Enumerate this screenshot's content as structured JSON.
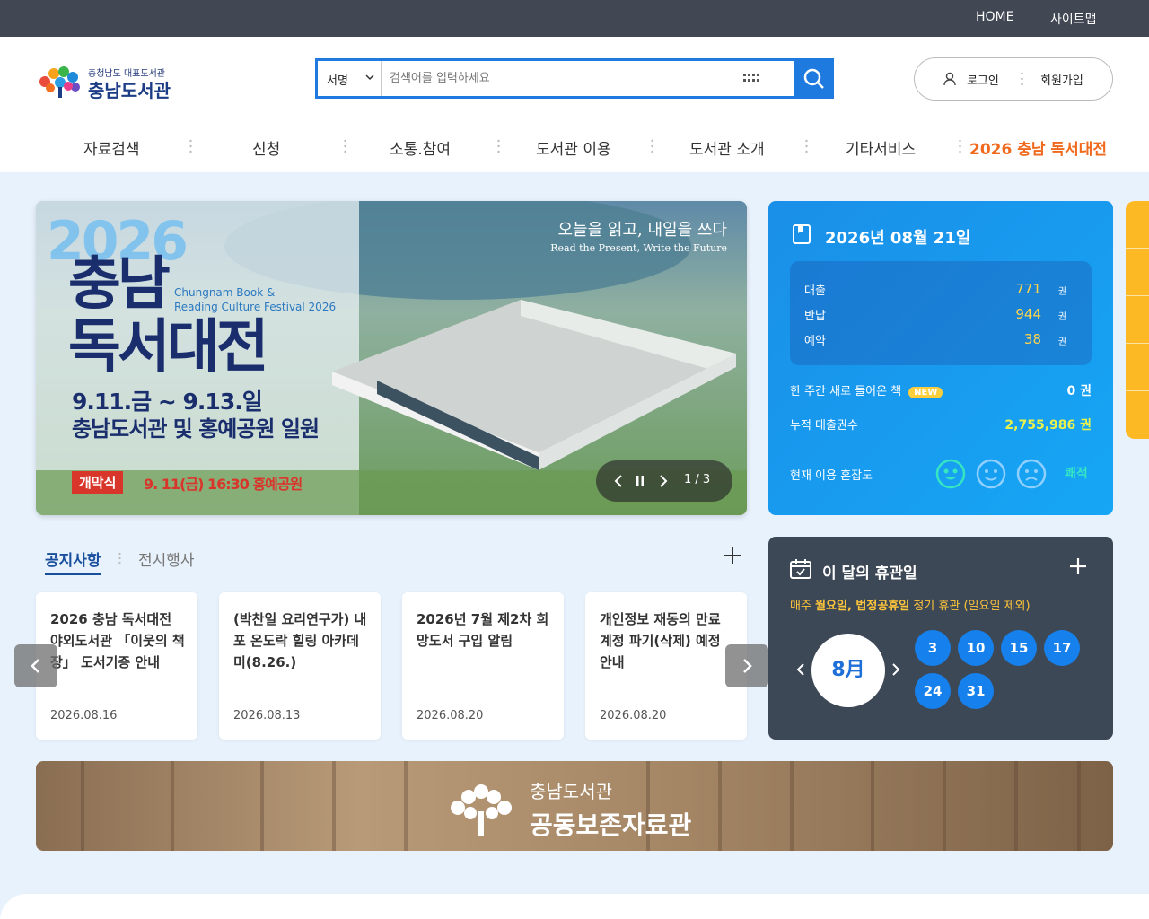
{
  "topbar": {
    "home": "HOME",
    "sitemap": "사이트맵"
  },
  "logo": {
    "sub": "충청남도 대표도서관",
    "main": "충남도서관"
  },
  "search": {
    "select": "서명",
    "placeholder": "검색어를 입력하세요"
  },
  "auth": {
    "login": "로그인",
    "join": "회원가입"
  },
  "gnb": [
    "자료검색",
    "신청",
    "소통.참여",
    "도서관 이용",
    "도서관 소개",
    "기타서비스",
    "2026 충남 독서대전"
  ],
  "banner": {
    "slogan1": "오늘을 읽고, 내일을 쓰다",
    "slogan2": "Read the Present, Write the Future",
    "year": "2026",
    "title1": "충남",
    "title2": "독서대전",
    "english1": "Chungnam Book &",
    "english2": "Reading Culture Festival 2026",
    "date": "9.11.금 ~ 9.13.일",
    "place": "충남도서관 및 홍예공원 일원",
    "open_badge": "개막식",
    "open_time": "9. 11(금) 16:30 홍예공원",
    "page": "1 / 3"
  },
  "info": {
    "date": "2026년 08월 21일",
    "rows": [
      {
        "label": "대출",
        "value": "771",
        "unit": "권"
      },
      {
        "label": "반납",
        "value": "944",
        "unit": "권"
      },
      {
        "label": "예약",
        "value": "38",
        "unit": "권"
      }
    ],
    "new_books_label": "한 주간 새로 들어온 책",
    "new_badge": "NEW",
    "new_books_value": "0 권",
    "total_label": "누적 대출권수",
    "total_value": "2,755,986 권",
    "congestion_label": "현재 이용 혼잡도",
    "congestion_value": "쾌적"
  },
  "tabs": {
    "notice": "공지사항",
    "exhibit": "전시행사"
  },
  "cards": [
    {
      "title": "2026 충남 독서대전 야외도서관 「이웃의 책장」 도서기증 안내",
      "date": "2026.08.16"
    },
    {
      "title": "(박찬일 요리연구가) 내포 온도락 힐링 아카데미(8.26.)",
      "date": "2026.08.13"
    },
    {
      "title": "2026년 7월 제2차 희망도서 구입 알림",
      "date": "2026.08.20"
    },
    {
      "title": "개인정보 재동의 만료 계정 파기(삭제) 예정 안내",
      "date": "2026.08.20"
    }
  ],
  "holiday": {
    "title": "이 달의 휴관일",
    "note_prefix": "매주 ",
    "note_bold": "월요일, 법정공휴일",
    "note_suffix": " 정기 휴관 (일요일 제외)",
    "month": "8月",
    "days": [
      "3",
      "10",
      "15",
      "17",
      "24",
      "31"
    ]
  },
  "archive": {
    "line1": "충남도서관",
    "line2": "공동보존자료관"
  },
  "colors": {
    "accent": "#1f7ae0",
    "highlight": "#f06a1e",
    "holiday_panel": "#3d4856",
    "info_panel": "#1a8fe8"
  }
}
